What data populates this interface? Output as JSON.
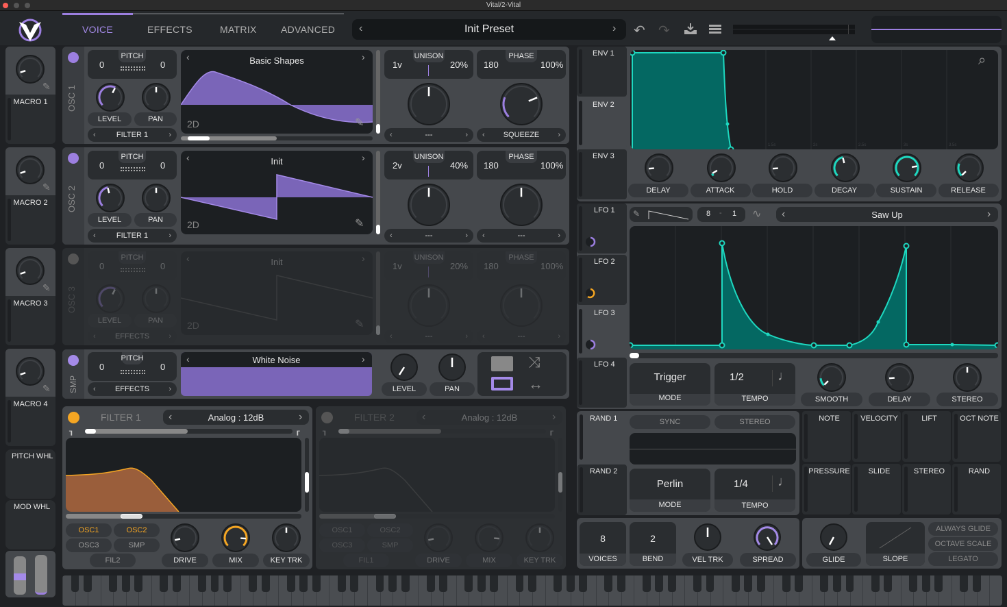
{
  "window": {
    "title": "Vital/2-Vital"
  },
  "tabs": [
    {
      "label": "VOICE",
      "active": true
    },
    {
      "label": "EFFECTS"
    },
    {
      "label": "MATRIX"
    },
    {
      "label": "ADVANCED"
    }
  ],
  "preset": {
    "name": "Init Preset"
  },
  "colors": {
    "accent": "#9c7fe0",
    "filter": "#f5a623",
    "mod": "#1ed8c0",
    "bg": "#1f2124",
    "panel": "#45484c"
  },
  "macros": [
    {
      "label": "MACRO 1",
      "value": 0.1
    },
    {
      "label": "MACRO 2",
      "value": 0.1
    },
    {
      "label": "MACRO 3",
      "value": 0.1
    },
    {
      "label": "MACRO 4",
      "value": 0.1
    }
  ],
  "wheels": {
    "pitch_label": "PITCH WHL",
    "mod_label": "MOD WHL"
  },
  "oscillators": [
    {
      "name": "OSC 1",
      "enabled": true,
      "pitch_left": "0",
      "pitch_label": "PITCH",
      "pitch_right": "0",
      "wavetable": "Basic Shapes",
      "mode": "2D",
      "level_label": "LEVEL",
      "pan_label": "PAN",
      "destination": "FILTER 1",
      "unison_label": "UNISON",
      "unison_voices": "1v",
      "unison_detune": "20%",
      "phase_label": "PHASE",
      "phase": "180",
      "phase_rand": "100%",
      "spectral_mode": "---",
      "distortion_mode": "SQUEEZE"
    },
    {
      "name": "OSC 2",
      "enabled": true,
      "pitch_left": "0",
      "pitch_label": "PITCH",
      "pitch_right": "0",
      "wavetable": "Init",
      "mode": "2D",
      "level_label": "LEVEL",
      "pan_label": "PAN",
      "destination": "FILTER 1",
      "unison_label": "UNISON",
      "unison_voices": "2v",
      "unison_detune": "40%",
      "phase_label": "PHASE",
      "phase": "180",
      "phase_rand": "100%",
      "spectral_mode": "---",
      "distortion_mode": "---"
    },
    {
      "name": "OSC 3",
      "enabled": false,
      "pitch_left": "0",
      "pitch_label": "PITCH",
      "pitch_right": "0",
      "wavetable": "Init",
      "mode": "2D",
      "level_label": "LEVEL",
      "pan_label": "PAN",
      "destination": "EFFECTS",
      "unison_label": "UNISON",
      "unison_voices": "1v",
      "unison_detune": "20%",
      "phase_label": "PHASE",
      "phase": "180",
      "phase_rand": "100%",
      "spectral_mode": "---",
      "distortion_mode": "---"
    }
  ],
  "sampler": {
    "name": "SMP",
    "pitch_left": "0",
    "pitch_label": "PITCH",
    "pitch_right": "0",
    "sample": "White Noise",
    "destination": "EFFECTS",
    "level_label": "LEVEL",
    "pan_label": "PAN"
  },
  "filters": [
    {
      "name": "FILTER 1",
      "enabled": true,
      "model": "Analog : 12dB",
      "sources": [
        "OSC1",
        "OSC2",
        "OSC3",
        "SMP"
      ],
      "active_sources": [
        "OSC1",
        "OSC2"
      ],
      "route": "FIL2",
      "knobs": [
        "DRIVE",
        "MIX",
        "KEY TRK"
      ]
    },
    {
      "name": "FILTER 2",
      "enabled": false,
      "model": "Analog : 12dB",
      "sources": [
        "OSC1",
        "OSC2",
        "OSC3",
        "SMP"
      ],
      "active_sources": [],
      "route": "FIL1",
      "knobs": [
        "DRIVE",
        "MIX",
        "KEY TRK"
      ]
    }
  ],
  "envelopes": {
    "tabs": [
      "ENV 1",
      "ENV 2",
      "ENV 3"
    ],
    "selected": "ENV 2",
    "time_ticks": [
      "500ms",
      "1s",
      "1.5s",
      "2s",
      "2.5s",
      "3s",
      "3.5s"
    ],
    "knobs": [
      "DELAY",
      "ATTACK",
      "HOLD",
      "DECAY",
      "SUSTAIN",
      "RELEASE"
    ]
  },
  "lfos": {
    "tabs": [
      "LFO 1",
      "LFO 2",
      "LFO 3",
      "LFO 4"
    ],
    "selected": "LFO 3",
    "grid_x": "8",
    "grid_y": "1",
    "shape": "Saw Up",
    "mode": "Trigger",
    "mode_label": "MODE",
    "tempo": "1/2",
    "tempo_label": "TEMPO",
    "knobs": [
      "SMOOTH",
      "DELAY",
      "STEREO"
    ]
  },
  "randoms": {
    "tabs": [
      "RAND 1",
      "RAND 2"
    ],
    "sync": "SYNC",
    "stereo": "STEREO",
    "mode": "Perlin",
    "mode_label": "MODE",
    "tempo": "1/4",
    "tempo_label": "TEMPO"
  },
  "mod_sources": [
    "NOTE",
    "VELOCITY",
    "LIFT",
    "OCT NOTE",
    "PRESSURE",
    "SLIDE",
    "STEREO",
    "RAND"
  ],
  "voice": {
    "voices": "8",
    "voices_label": "VOICES",
    "bend": "2",
    "bend_label": "BEND",
    "vel_trk": "VEL TRK",
    "spread": "SPREAD"
  },
  "glide": {
    "glide_label": "GLIDE",
    "slope_label": "SLOPE",
    "always_glide": "ALWAYS GLIDE",
    "octave_scale": "OCTAVE SCALE",
    "legato": "LEGATO"
  }
}
